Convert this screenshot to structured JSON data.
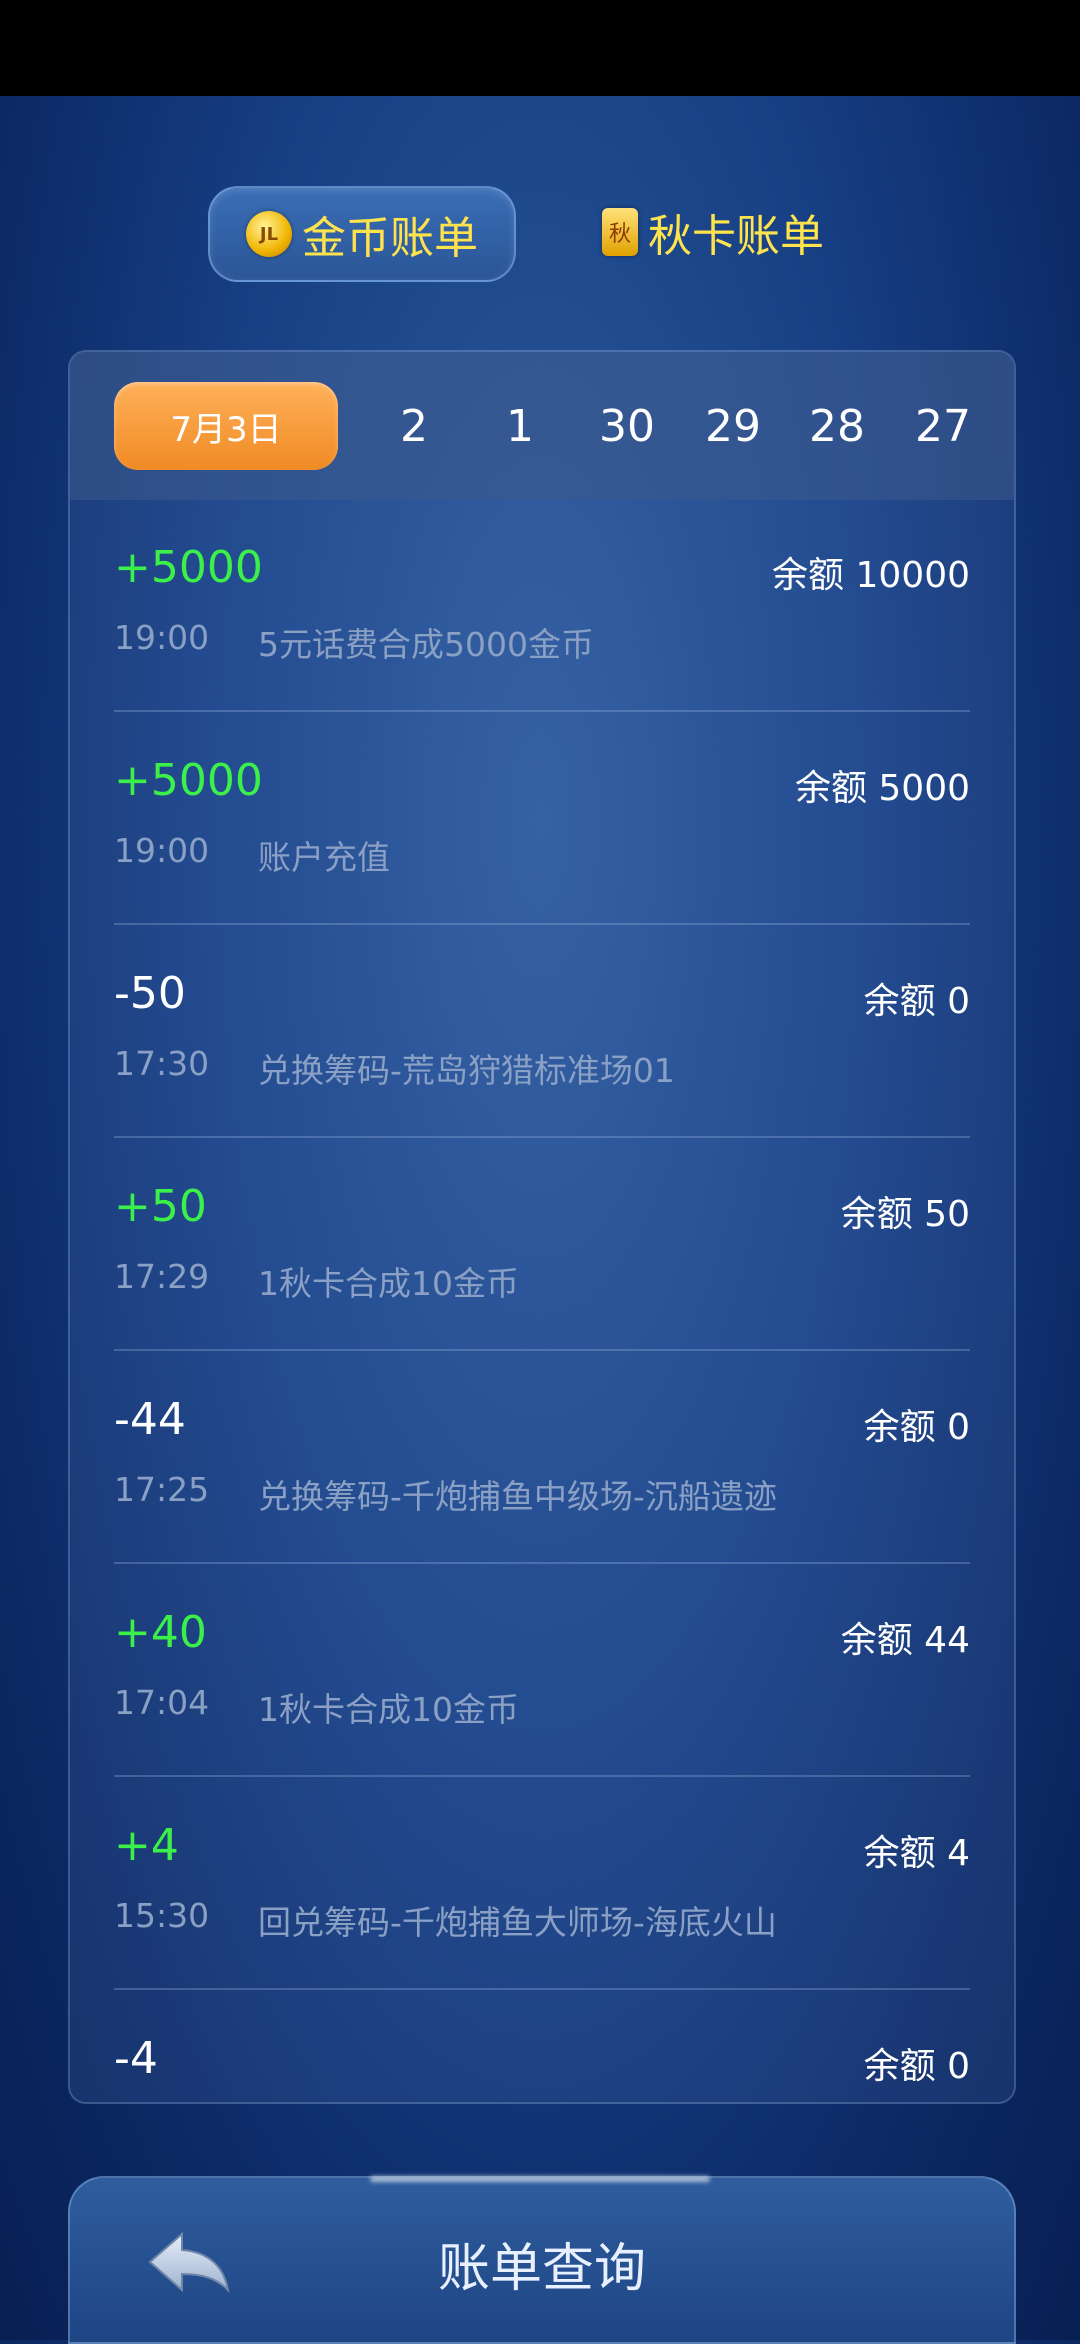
{
  "tabs": [
    {
      "label": "金币账单",
      "icon": "coin-icon",
      "icon_text": "JL",
      "active": true
    },
    {
      "label": "秋卡账单",
      "icon": "card-icon",
      "icon_text": "秋",
      "active": false
    }
  ],
  "dates": [
    "7月3日",
    "2",
    "1",
    "30",
    "29",
    "28",
    "27"
  ],
  "records": [
    {
      "amount": "+5000",
      "sign": "pos",
      "balance": "余额 10000",
      "time": "19:00",
      "desc": "5元话费合成5000金币"
    },
    {
      "amount": "+5000",
      "sign": "pos",
      "balance": "余额 5000",
      "time": "19:00",
      "desc": "账户充值"
    },
    {
      "amount": "-50",
      "sign": "neg",
      "balance": "余额 0",
      "time": "17:30",
      "desc": "兑换筹码-荒岛狩猎标准场01"
    },
    {
      "amount": "+50",
      "sign": "pos",
      "balance": "余额 50",
      "time": "17:29",
      "desc": "1秋卡合成10金币"
    },
    {
      "amount": "-44",
      "sign": "neg",
      "balance": "余额 0",
      "time": "17:25",
      "desc": "兑换筹码-千炮捕鱼中级场-沉船遗迹"
    },
    {
      "amount": "+40",
      "sign": "pos",
      "balance": "余额 44",
      "time": "17:04",
      "desc": "1秋卡合成10金币"
    },
    {
      "amount": "+4",
      "sign": "pos",
      "balance": "余额 4",
      "time": "15:30",
      "desc": "回兑筹码-千炮捕鱼大师场-海底火山"
    },
    {
      "amount": "-4",
      "sign": "neg",
      "balance": "余额 0",
      "time": "",
      "desc": ""
    }
  ],
  "bottom_bar": {
    "title": "账单查询",
    "back_icon": "back-arrow-icon"
  },
  "colors": {
    "positive": "#3cf04a",
    "negative": "#ffffff",
    "tab_text": "#ffe34d",
    "date_selected": "#f08a24"
  }
}
